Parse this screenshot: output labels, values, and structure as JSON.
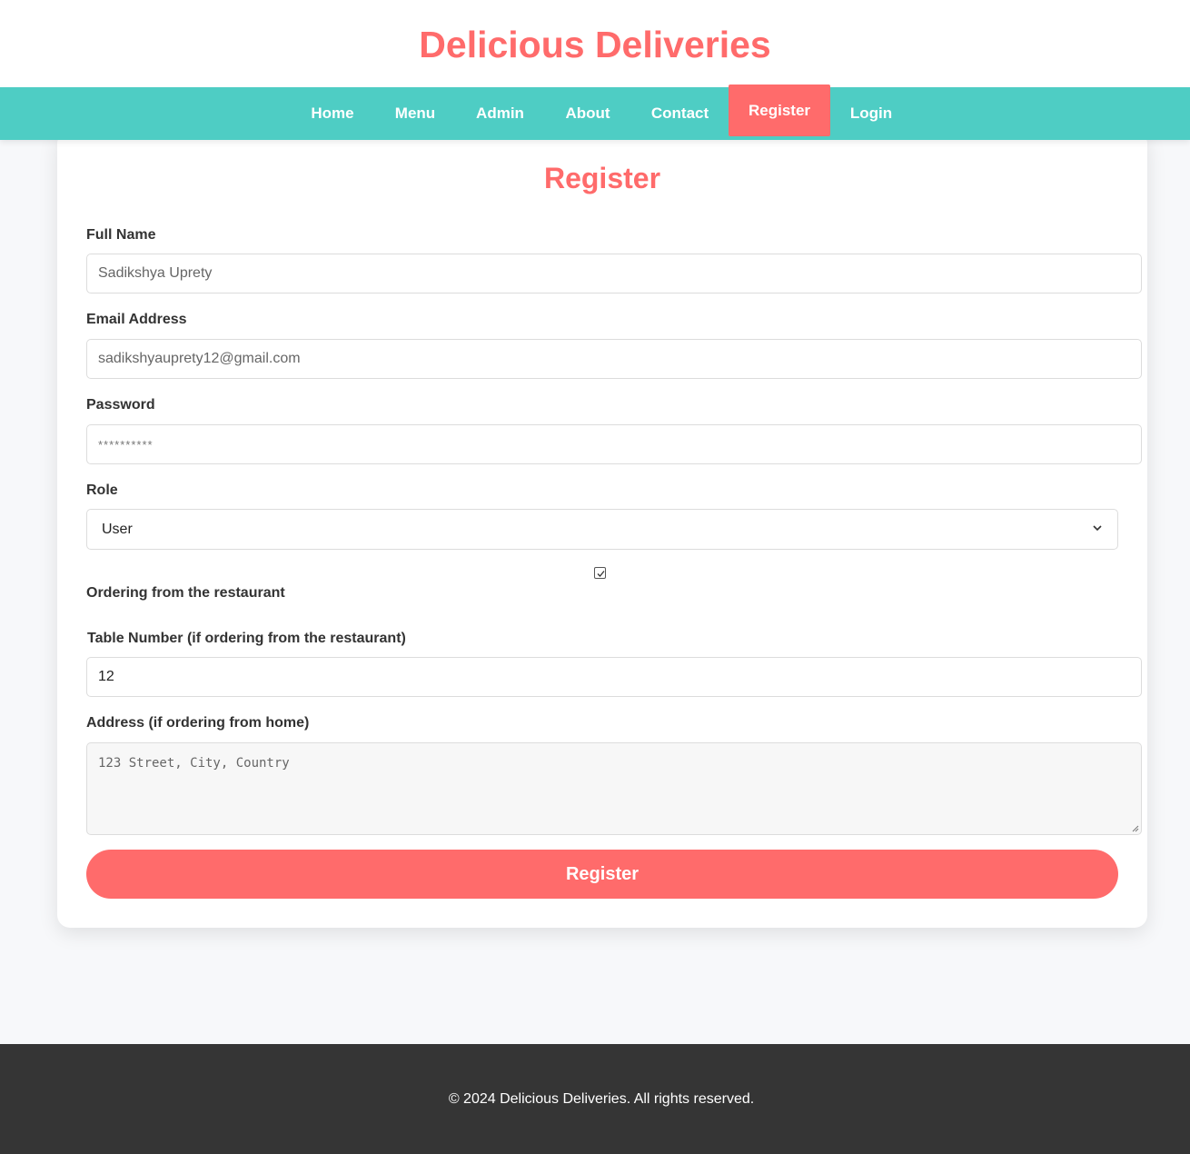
{
  "header": {
    "title": "Delicious Deliveries"
  },
  "nav": {
    "items": [
      {
        "label": "Home"
      },
      {
        "label": "Menu"
      },
      {
        "label": "Admin"
      },
      {
        "label": "About"
      },
      {
        "label": "Contact"
      },
      {
        "label": "Register",
        "active": true
      },
      {
        "label": "Login"
      }
    ]
  },
  "form": {
    "title": "Register",
    "full_name": {
      "label": "Full Name",
      "placeholder": "Sadikshya Uprety"
    },
    "email": {
      "label": "Email Address",
      "placeholder": "sadikshyauprety12@gmail.com"
    },
    "password": {
      "label": "Password",
      "placeholder": "**********"
    },
    "role": {
      "label": "Role",
      "value": "User"
    },
    "ordering": {
      "label": "Ordering from the restaurant",
      "checked": true
    },
    "table_number": {
      "label": "Table Number (if ordering from the restaurant)",
      "value": "12"
    },
    "address": {
      "label": "Address (if ordering from home)",
      "placeholder": "123 Street, City, Country"
    },
    "submit_label": "Register"
  },
  "footer": {
    "text": "© 2024 Delicious Deliveries. All rights reserved."
  },
  "colors": {
    "accent": "#ff6b6b",
    "nav": "#4ecdc4",
    "footer": "#353535"
  }
}
